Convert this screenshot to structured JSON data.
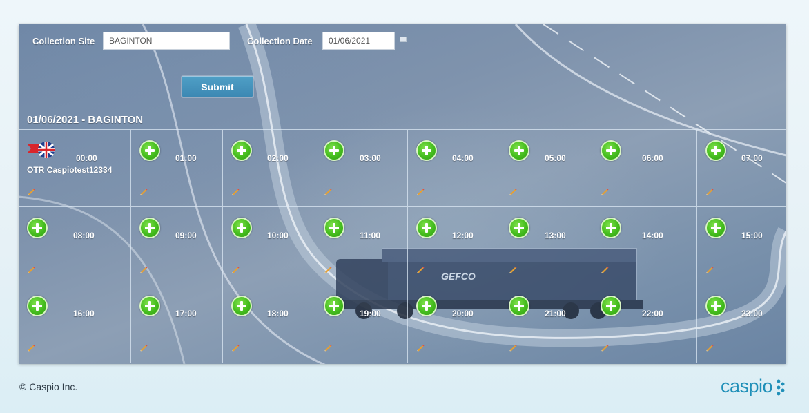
{
  "form": {
    "site_label": "Collection Site",
    "site_value": "BAGINTON",
    "date_label": "Collection Date",
    "date_value": "01/06/2021",
    "submit_label": "Submit"
  },
  "schedule": {
    "title": "01/06/2021 - BAGINTON",
    "slots": [
      {
        "time": "00:00",
        "booking": "OTR Caspiotest12334",
        "flag": "gb-flag-icon"
      },
      {
        "time": "01:00"
      },
      {
        "time": "02:00"
      },
      {
        "time": "03:00"
      },
      {
        "time": "04:00"
      },
      {
        "time": "05:00"
      },
      {
        "time": "06:00"
      },
      {
        "time": "07:00"
      },
      {
        "time": "08:00"
      },
      {
        "time": "09:00"
      },
      {
        "time": "10:00"
      },
      {
        "time": "11:00"
      },
      {
        "time": "12:00"
      },
      {
        "time": "13:00"
      },
      {
        "time": "14:00"
      },
      {
        "time": "15:00"
      },
      {
        "time": "16:00"
      },
      {
        "time": "17:00"
      },
      {
        "time": "18:00"
      },
      {
        "time": "19:00"
      },
      {
        "time": "20:00"
      },
      {
        "time": "21:00"
      },
      {
        "time": "22:00"
      },
      {
        "time": "23:00"
      }
    ]
  },
  "background": {
    "truck_text": "GEFCO"
  },
  "footer": {
    "copyright": "© Caspio Inc.",
    "logo_text": "caspio"
  },
  "colors": {
    "accent": "#3c88b3",
    "add_icon": "#45bd1e",
    "logo": "#1f8fb8"
  }
}
